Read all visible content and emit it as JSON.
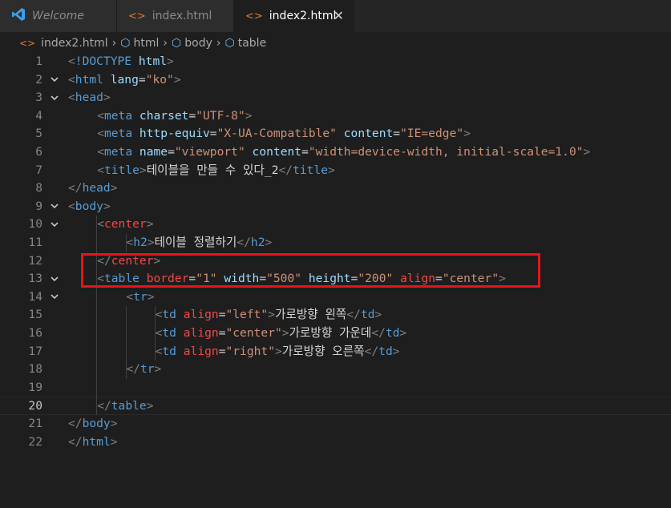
{
  "tabs": [
    {
      "label": "Welcome",
      "icon": "vscode-logo-icon",
      "active": false
    },
    {
      "label": "index.html",
      "icon": "html-file-icon",
      "active": false
    },
    {
      "label": "index2.html",
      "icon": "html-file-icon",
      "active": true,
      "close": "✕"
    }
  ],
  "breadcrumb": [
    "index2.html",
    "html",
    "body",
    "table"
  ],
  "colors": {
    "background": "#1e1e1e",
    "tag": "#569cd6",
    "attribute": "#9cdcfe",
    "string": "#ce9178",
    "deprecated": "#f44747",
    "highlight_box": "#e8141a"
  },
  "editor": {
    "current_line": 20,
    "lines": [
      {
        "n": "1",
        "fold": "",
        "indent": 0,
        "tokens": [
          [
            "t-punct",
            "<"
          ],
          [
            "t-doctype",
            "!DOCTYPE "
          ],
          [
            "t-attr",
            "html"
          ],
          [
            "t-punct",
            ">"
          ]
        ]
      },
      {
        "n": "2",
        "fold": "v",
        "indent": 0,
        "tokens": [
          [
            "t-punct",
            "<"
          ],
          [
            "t-tag",
            "html "
          ],
          [
            "t-attr",
            "lang"
          ],
          [
            "t-txt",
            "="
          ],
          [
            "t-str",
            "\"ko\""
          ],
          [
            "t-punct",
            ">"
          ]
        ]
      },
      {
        "n": "3",
        "fold": "v",
        "indent": 0,
        "tokens": [
          [
            "t-punct",
            "<"
          ],
          [
            "t-tag",
            "head"
          ],
          [
            "t-punct",
            ">"
          ]
        ]
      },
      {
        "n": "4",
        "fold": "",
        "indent": 1,
        "tokens": [
          [
            "t-punct",
            "<"
          ],
          [
            "t-tag",
            "meta "
          ],
          [
            "t-attr",
            "charset"
          ],
          [
            "t-txt",
            "="
          ],
          [
            "t-str",
            "\"UTF-8\""
          ],
          [
            "t-punct",
            ">"
          ]
        ]
      },
      {
        "n": "5",
        "fold": "",
        "indent": 1,
        "tokens": [
          [
            "t-punct",
            "<"
          ],
          [
            "t-tag",
            "meta "
          ],
          [
            "t-attr",
            "http-equiv"
          ],
          [
            "t-txt",
            "="
          ],
          [
            "t-str",
            "\"X-UA-Compatible\""
          ],
          [
            "t-txt",
            " "
          ],
          [
            "t-attr",
            "content"
          ],
          [
            "t-txt",
            "="
          ],
          [
            "t-str",
            "\"IE=edge\""
          ],
          [
            "t-punct",
            ">"
          ]
        ]
      },
      {
        "n": "6",
        "fold": "",
        "indent": 1,
        "tokens": [
          [
            "t-punct",
            "<"
          ],
          [
            "t-tag",
            "meta "
          ],
          [
            "t-attr",
            "name"
          ],
          [
            "t-txt",
            "="
          ],
          [
            "t-str",
            "\"viewport\""
          ],
          [
            "t-txt",
            " "
          ],
          [
            "t-attr",
            "content"
          ],
          [
            "t-txt",
            "="
          ],
          [
            "t-str",
            "\"width=device-width, initial-scale=1.0\""
          ],
          [
            "t-punct",
            ">"
          ]
        ]
      },
      {
        "n": "7",
        "fold": "",
        "indent": 1,
        "tokens": [
          [
            "t-punct",
            "<"
          ],
          [
            "t-tag",
            "title"
          ],
          [
            "t-punct",
            ">"
          ],
          [
            "t-txt",
            "테이블을 만들 수 있다_2"
          ],
          [
            "t-punct",
            "</"
          ],
          [
            "t-tag",
            "title"
          ],
          [
            "t-punct",
            ">"
          ]
        ]
      },
      {
        "n": "8",
        "fold": "",
        "indent": 0,
        "tokens": [
          [
            "t-punct",
            "</"
          ],
          [
            "t-tag",
            "head"
          ],
          [
            "t-punct",
            ">"
          ]
        ]
      },
      {
        "n": "9",
        "fold": "v",
        "indent": 0,
        "tokens": [
          [
            "t-punct",
            "<"
          ],
          [
            "t-tag",
            "body"
          ],
          [
            "t-punct",
            ">"
          ]
        ]
      },
      {
        "n": "10",
        "fold": "v",
        "indent": 1,
        "tokens": [
          [
            "t-punct",
            "<"
          ],
          [
            "t-dep",
            "center"
          ],
          [
            "t-punct",
            ">"
          ]
        ]
      },
      {
        "n": "11",
        "fold": "",
        "indent": 2,
        "tokens": [
          [
            "t-punct",
            "<"
          ],
          [
            "t-tag",
            "h2"
          ],
          [
            "t-punct",
            ">"
          ],
          [
            "t-txt",
            "테이블 정렬하기"
          ],
          [
            "t-punct",
            "</"
          ],
          [
            "t-tag",
            "h2"
          ],
          [
            "t-punct",
            ">"
          ]
        ]
      },
      {
        "n": "12",
        "fold": "",
        "indent": 1,
        "tokens": [
          [
            "t-punct",
            "</"
          ],
          [
            "t-dep",
            "center"
          ],
          [
            "t-punct",
            ">"
          ]
        ]
      },
      {
        "n": "13",
        "fold": "v",
        "indent": 1,
        "tokens": [
          [
            "t-punct",
            "<"
          ],
          [
            "t-tag",
            "table "
          ],
          [
            "t-dep",
            "border"
          ],
          [
            "t-txt",
            "="
          ],
          [
            "t-str",
            "\"1\""
          ],
          [
            "t-txt",
            " "
          ],
          [
            "t-attr",
            "width"
          ],
          [
            "t-txt",
            "="
          ],
          [
            "t-str",
            "\"500\""
          ],
          [
            "t-txt",
            " "
          ],
          [
            "t-attr",
            "height"
          ],
          [
            "t-txt",
            "="
          ],
          [
            "t-str",
            "\"200\""
          ],
          [
            "t-txt",
            " "
          ],
          [
            "t-dep",
            "align"
          ],
          [
            "t-txt",
            "="
          ],
          [
            "t-str",
            "\"center\""
          ],
          [
            "t-punct",
            ">"
          ]
        ]
      },
      {
        "n": "14",
        "fold": "v",
        "indent": 2,
        "tokens": [
          [
            "t-punct",
            "<"
          ],
          [
            "t-tag",
            "tr"
          ],
          [
            "t-punct",
            ">"
          ]
        ]
      },
      {
        "n": "15",
        "fold": "",
        "indent": 3,
        "tokens": [
          [
            "t-punct",
            "<"
          ],
          [
            "t-tag",
            "td "
          ],
          [
            "t-dep",
            "align"
          ],
          [
            "t-txt",
            "="
          ],
          [
            "t-str",
            "\"left\""
          ],
          [
            "t-punct",
            ">"
          ],
          [
            "t-txt",
            "가로방향 왼쪽"
          ],
          [
            "t-punct",
            "</"
          ],
          [
            "t-tag",
            "td"
          ],
          [
            "t-punct",
            ">"
          ]
        ]
      },
      {
        "n": "16",
        "fold": "",
        "indent": 3,
        "tokens": [
          [
            "t-punct",
            "<"
          ],
          [
            "t-tag",
            "td "
          ],
          [
            "t-dep",
            "align"
          ],
          [
            "t-txt",
            "="
          ],
          [
            "t-str",
            "\"center\""
          ],
          [
            "t-punct",
            ">"
          ],
          [
            "t-txt",
            "가로방향 가운데"
          ],
          [
            "t-punct",
            "</"
          ],
          [
            "t-tag",
            "td"
          ],
          [
            "t-punct",
            ">"
          ]
        ]
      },
      {
        "n": "17",
        "fold": "",
        "indent": 3,
        "tokens": [
          [
            "t-punct",
            "<"
          ],
          [
            "t-tag",
            "td "
          ],
          [
            "t-dep",
            "align"
          ],
          [
            "t-txt",
            "="
          ],
          [
            "t-str",
            "\"right\""
          ],
          [
            "t-punct",
            ">"
          ],
          [
            "t-txt",
            "가로방향 오른쪽"
          ],
          [
            "t-punct",
            "</"
          ],
          [
            "t-tag",
            "td"
          ],
          [
            "t-punct",
            ">"
          ]
        ]
      },
      {
        "n": "18",
        "fold": "",
        "indent": 2,
        "tokens": [
          [
            "t-punct",
            "</"
          ],
          [
            "t-tag",
            "tr"
          ],
          [
            "t-punct",
            ">"
          ]
        ]
      },
      {
        "n": "19",
        "fold": "",
        "indent": 0,
        "tokens": []
      },
      {
        "n": "20",
        "fold": "",
        "indent": 1,
        "tokens": [
          [
            "t-punct",
            "</"
          ],
          [
            "t-tag",
            "table"
          ],
          [
            "t-punct",
            ">"
          ]
        ]
      },
      {
        "n": "21",
        "fold": "",
        "indent": 0,
        "tokens": [
          [
            "t-punct",
            "</"
          ],
          [
            "t-tag",
            "body"
          ],
          [
            "t-punct",
            ">"
          ]
        ]
      },
      {
        "n": "22",
        "fold": "",
        "indent": 0,
        "tokens": [
          [
            "t-punct",
            "</"
          ],
          [
            "t-tag",
            "html"
          ],
          [
            "t-punct",
            ">"
          ]
        ]
      }
    ]
  }
}
